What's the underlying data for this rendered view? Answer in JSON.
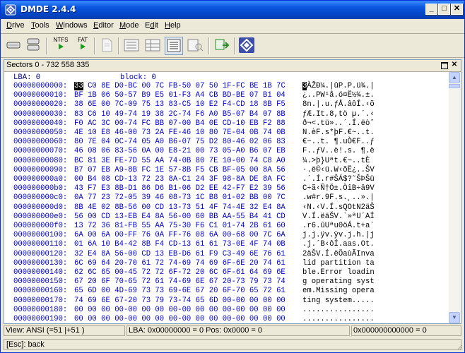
{
  "window": {
    "title": "DMDE 2.4.4",
    "controls": {
      "minimize": "_",
      "maximize": "□",
      "close": "✕"
    }
  },
  "menu": [
    {
      "label": "Drive",
      "accel": "D",
      "rest": "rive"
    },
    {
      "label": "Tools",
      "accel": "T",
      "rest": "ools"
    },
    {
      "label": "Windows",
      "accel": "W",
      "rest": "indows"
    },
    {
      "label": "Editor",
      "accel": "E",
      "rest": "ditor"
    },
    {
      "label": "Mode",
      "accel": "M",
      "rest": "ode"
    },
    {
      "label": "Edit",
      "accel": "Ed",
      "rest": "it",
      "underline_index": 1
    },
    {
      "label": "Help",
      "accel": "H",
      "rest": "elp"
    }
  ],
  "toolbar": {
    "ntfs_label": "NTFS",
    "fat_label": "FAT",
    "icons": [
      "disk-icon",
      "partitions-icon",
      "ntfs-run-icon",
      "fat-run-icon",
      "new-document-icon",
      "view-list-icon",
      "view-table-icon",
      "view-hex-icon",
      "view-text-icon",
      "file-write-icon",
      "dmde-logo-icon"
    ]
  },
  "panel": {
    "title": "Sectors 0 - 732 558 335",
    "header_lba_label": "LBA: 0",
    "header_block_label": "block: 0"
  },
  "hex_rows": [
    {
      "offset": "00000000000:",
      "hex": "33 C0 8E D0-BC 00 7C FB-50 07 50 1F-FC BE 1B 7C",
      "ascii": "3ÀŽÐ¼.|ûP.P.ü¾.|"
    },
    {
      "offset": "00000000010:",
      "hex": "BF 1B 06 50-57 B9 E5 01-F3 A4 CB BD-BE 07 B1 04",
      "ascii": "¿..PW¹å.ó¤Ë½¾.±."
    },
    {
      "offset": "00000000020:",
      "hex": "38 6E 00 7C-09 75 13 83-C5 10 E2 F4-CD 18 8B F5",
      "ascii": "8n.|.u.ƒÅ.âôÍ.‹õ"
    },
    {
      "offset": "00000000030:",
      "hex": "83 C6 10 49-74 19 38 2C-74 F6 A0 B5-07 B4 07 8B",
      "ascii": "ƒÆ.It.8,tö µ.´.‹"
    },
    {
      "offset": "00000000040:",
      "hex": "F0 AC 3C 00-74 FC BB 07-00 B4 0E CD-10 EB F2 88",
      "ascii": "ð¬<.tü»..´.Í.ëòˆ"
    },
    {
      "offset": "00000000050:",
      "hex": "4E 10 E8 46-00 73 2A FE-46 10 80 7E-04 0B 74 0B",
      "ascii": "N.èF.s*þF.€~..t."
    },
    {
      "offset": "00000000060:",
      "hex": "80 7E 04 0C-74 05 A0 B6-07 75 D2 80-46 02 06 83",
      "ascii": "€~..t. ¶.uÒ€F..ƒ"
    },
    {
      "offset": "00000000070:",
      "hex": "46 08 06 83-56 0A 00 E8-21 00 73 05-A0 B6 07 EB",
      "ascii": "F..ƒV..è!.s. ¶.ë"
    },
    {
      "offset": "00000000080:",
      "hex": "BC 81 3E FE-7D 55 AA 74-0B 80 7E 10-00 74 C8 A0",
      "ascii": "¼.>þ}Uªt.€~..tÈ "
    },
    {
      "offset": "00000000090:",
      "hex": "B7 07 EB A9-8B FC 1E 57-8B F5 CB BF-05 00 8A 56",
      "ascii": "·.ë©‹ü.W‹õË¿..ŠV"
    },
    {
      "offset": "000000000a0:",
      "hex": "00 B4 08 CD-13 72 23 8A-C1 24 3F 98-8A DE 8A FC",
      "ascii": ".´.Í.r#ŠÁ$?˜ŠÞŠü"
    },
    {
      "offset": "000000000b0:",
      "hex": "43 F7 E3 8B-D1 86 D6 B1-06 D2 EE 42-F7 E2 39 56",
      "ascii": "C÷ã‹Ñ†Ö±.ÒîB÷â9V"
    },
    {
      "offset": "000000000c0:",
      "hex": "0A 77 23 72-05 39 46 08-73 1C B8 01-02 BB 00 7C",
      "ascii": ".w#r.9F.s.¸..».|"
    },
    {
      "offset": "000000000d0:",
      "hex": "8B 4E 02 8B-56 00 CD 13-73 51 4F 74-4E 32 E4 8A",
      "ascii": "‹N.‹V.Í.sQOtN2äŠ"
    },
    {
      "offset": "000000000e0:",
      "hex": "56 00 CD 13-EB E4 8A 56-00 60 BB AA-55 B4 41 CD",
      "ascii": "V.Í.ëäŠV.`»ªU´AÍ"
    },
    {
      "offset": "000000000f0:",
      "hex": "13 72 36 81-FB 55 AA 75-30 F6 C1 01-74 2B 61 60",
      "ascii": ".r6.ûUªu0öÁ.t+a`"
    },
    {
      "offset": "00000000100:",
      "hex": "6A 00 6A 00-FF 76 0A FF-76 08 6A 00-68 00 7C 6A",
      "ascii": "j.j.ÿv.ÿv.j.h.|j"
    },
    {
      "offset": "00000000110:",
      "hex": "01 6A 10 B4-42 8B F4 CD-13 61 61 73-0E 4F 74 0B",
      "ascii": ".j.´B‹ôÍ.aas.Ot."
    },
    {
      "offset": "00000000120:",
      "hex": "32 E4 8A 56-00 CD 13 EB-D6 61 F9 C3-49 6E 76 61",
      "ascii": "2äŠV.Í.ëÖaùÃInva"
    },
    {
      "offset": "00000000130:",
      "hex": "6C 69 64 20-70 61 72 74-69 74 69 6F-6E 20 74 61",
      "ascii": "lid partition ta"
    },
    {
      "offset": "00000000140:",
      "hex": "62 6C 65 00-45 72 72 6F-72 20 6C 6F-61 64 69 6E",
      "ascii": "ble.Error loadin"
    },
    {
      "offset": "00000000150:",
      "hex": "67 20 6F 70-65 72 61 74-69 6E 67 20-73 79 73 74",
      "ascii": "g operating syst"
    },
    {
      "offset": "00000000160:",
      "hex": "65 6D 00 4D-69 73 73 69-6E 67 20 6F-70 65 72 61",
      "ascii": "em.Missing opera"
    },
    {
      "offset": "00000000170:",
      "hex": "74 69 6E 67-20 73 79 73-74 65 6D 00-00 00 00 00",
      "ascii": "ting system....."
    },
    {
      "offset": "00000000180:",
      "hex": "00 00 00 00-00 00 00 00-00 00 00 00-00 00 00 00",
      "ascii": "................"
    },
    {
      "offset": "00000000190:",
      "hex": "00 00 00 00-00 00 00 00-00 00 00 00-00 00 00 00",
      "ascii": "................"
    }
  ],
  "status": {
    "view": "View: ANSI (=51 |+51 )",
    "lba_pos": "LBA: 0x00000000 = 0  Pos: 0x0000 = 0",
    "position": "0x000000000000 = 0",
    "hint": "[Esc]: back"
  }
}
